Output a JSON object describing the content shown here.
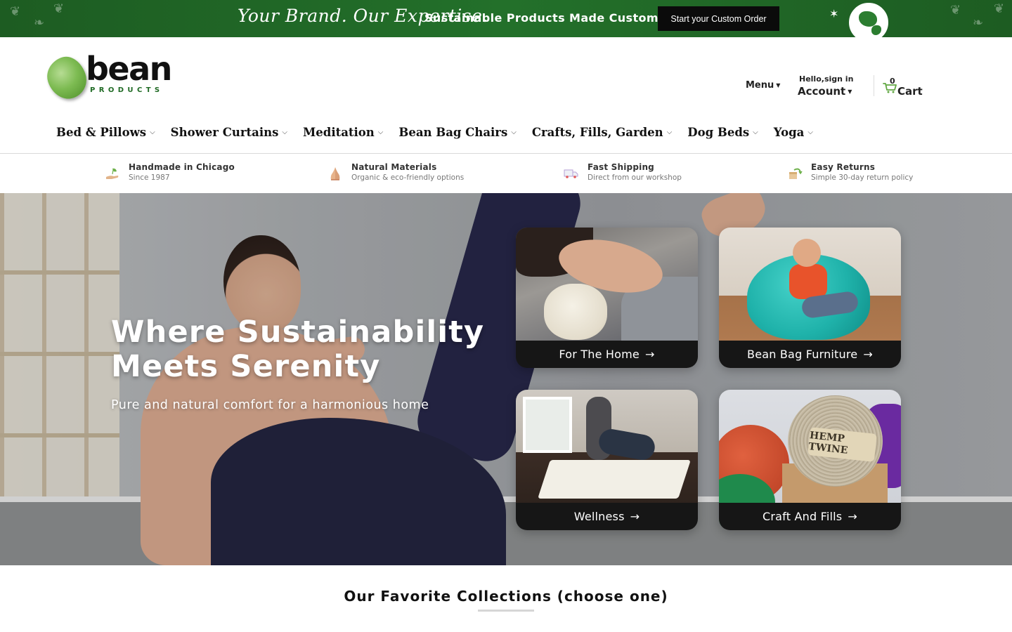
{
  "promo": {
    "script_text": "Your Brand. Our Expertise.",
    "headline": "Sustainable Products Made Custom",
    "cta_label": "Start your Custom Order",
    "bg_color": "#1d5c22"
  },
  "header": {
    "logo_word": "bean",
    "logo_sub": "PRODUCTS",
    "menu_label": "Menu",
    "hello_label": "Hello,sign in",
    "account_label": "Account",
    "cart_count": "0",
    "cart_label": "Cart",
    "cart_icon": "cart-icon"
  },
  "nav": {
    "items": [
      {
        "label": "Bed & Pillows"
      },
      {
        "label": "Shower Curtains"
      },
      {
        "label": "Meditation"
      },
      {
        "label": "Bean Bag Chairs"
      },
      {
        "label": "Crafts, Fills, Garden"
      },
      {
        "label": "Dog Beds"
      },
      {
        "label": "Yoga"
      }
    ]
  },
  "features": [
    {
      "title": "Handmade in Chicago",
      "subtitle": "Since 1987",
      "icon": "hand-leaf-icon"
    },
    {
      "title": "Natural Materials",
      "subtitle": "Organic & eco-friendly options",
      "icon": "praying-hands-icon"
    },
    {
      "title": "Fast Shipping",
      "subtitle": "Direct from our workshop",
      "icon": "truck-icon"
    },
    {
      "title": "Easy Returns",
      "subtitle": "Simple 30-day return policy",
      "icon": "return-box-icon"
    }
  ],
  "hero": {
    "title": "Where Sustainability Meets Serenity",
    "subtitle": "Pure and natural comfort for a harmonious home",
    "tiles": [
      {
        "label": "For The Home"
      },
      {
        "label": "Bean Bag Furniture"
      },
      {
        "label": "Wellness"
      },
      {
        "label": "Craft And Fills"
      }
    ],
    "twine_label": "HEMP TWINE"
  },
  "collections": {
    "title": "Our Favorite Collections (choose one)"
  }
}
